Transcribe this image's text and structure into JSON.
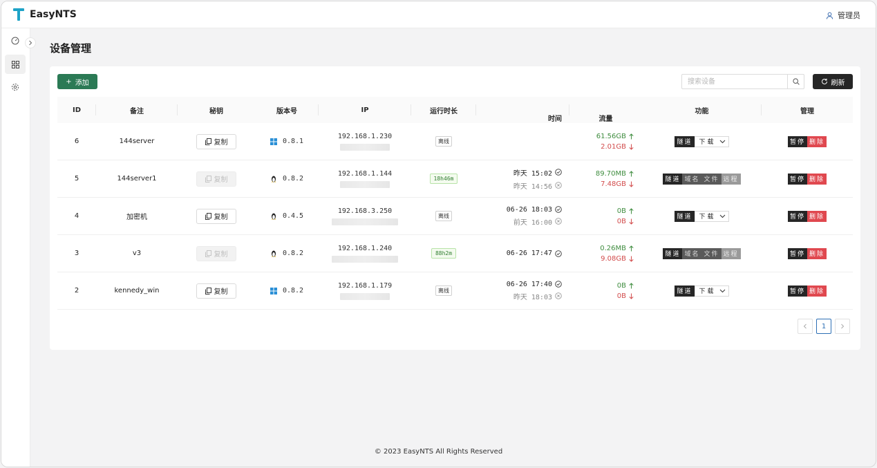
{
  "app": {
    "title": "EasyNTS",
    "user": "管理员"
  },
  "sidebar": {
    "items": [
      "dashboard",
      "devices",
      "settings"
    ]
  },
  "page": {
    "title": "设备管理"
  },
  "toolbar": {
    "add_label": "添加",
    "search_placeholder": "搜索设备",
    "refresh_label": "刷新"
  },
  "table": {
    "headers": {
      "id": "ID",
      "note": "备注",
      "key": "秘钥",
      "version": "版本号",
      "ip": "IP",
      "runtime": "运行时长",
      "time": "时间",
      "flow": "流量",
      "function": "功能",
      "manage": "管理"
    },
    "copy_label": "复制",
    "rows": [
      {
        "id": "6",
        "note": "144server",
        "copy_disabled": false,
        "os": "windows",
        "version": "0.8.1",
        "ip": "192.168.1.230",
        "runtime": "离线",
        "online": false,
        "time1": "",
        "time1_icon": "",
        "time2": "",
        "flow_up": "61.56GB",
        "flow_down": "2.01GB",
        "func": [
          "隧道",
          "下载"
        ],
        "func_type": "download"
      },
      {
        "id": "5",
        "note": "144server1",
        "copy_disabled": true,
        "os": "linux",
        "version": "0.8.2",
        "ip": "192.168.1.144",
        "runtime": "18h46m",
        "online": true,
        "time1": "昨天 15:02",
        "time1_icon": "check",
        "time2": "昨天 14:56",
        "flow_up": "89.70MB",
        "flow_down": "7.48GB",
        "func": [
          "隧道",
          "域名",
          "文件",
          "远程"
        ],
        "func_type": "full"
      },
      {
        "id": "4",
        "note": "加密机",
        "copy_disabled": false,
        "os": "linux",
        "version": "0.4.5",
        "ip": "192.168.3.250",
        "runtime": "离线",
        "online": false,
        "time1": "06-26 18:03",
        "time1_icon": "check",
        "time2": "前天 16:00",
        "flow_up": "0B",
        "flow_down": "0B",
        "func": [
          "隧道",
          "下载"
        ],
        "func_type": "download"
      },
      {
        "id": "3",
        "note": "v3",
        "copy_disabled": true,
        "os": "linux",
        "version": "0.8.2",
        "ip": "192.168.1.240",
        "runtime": "88h2m",
        "online": true,
        "time1": "06-26 17:47",
        "time1_icon": "check",
        "time2": "",
        "flow_up": "0.26MB",
        "flow_down": "9.08GB",
        "func": [
          "隧道",
          "域名",
          "文件",
          "远程"
        ],
        "func_type": "full"
      },
      {
        "id": "2",
        "note": "kennedy_win",
        "copy_disabled": false,
        "os": "windows",
        "version": "0.8.2",
        "ip": "192.168.1.179",
        "runtime": "离线",
        "online": false,
        "time1": "06-26 17:40",
        "time1_icon": "check",
        "time2": "昨天 18:03",
        "flow_up": "0B",
        "flow_down": "0B",
        "func": [
          "隧道",
          "下载"
        ],
        "func_type": "download"
      }
    ],
    "manage": {
      "pause": "暂停",
      "delete": "删除"
    }
  },
  "pagination": {
    "current": "1"
  },
  "footer": {
    "text": "© 2023 EasyNTS All Rights Reserved"
  },
  "colors": {
    "accent": "#2b7a55",
    "danger": "#e0484f",
    "up": "#3e8c3e",
    "down": "#d24b4b"
  }
}
